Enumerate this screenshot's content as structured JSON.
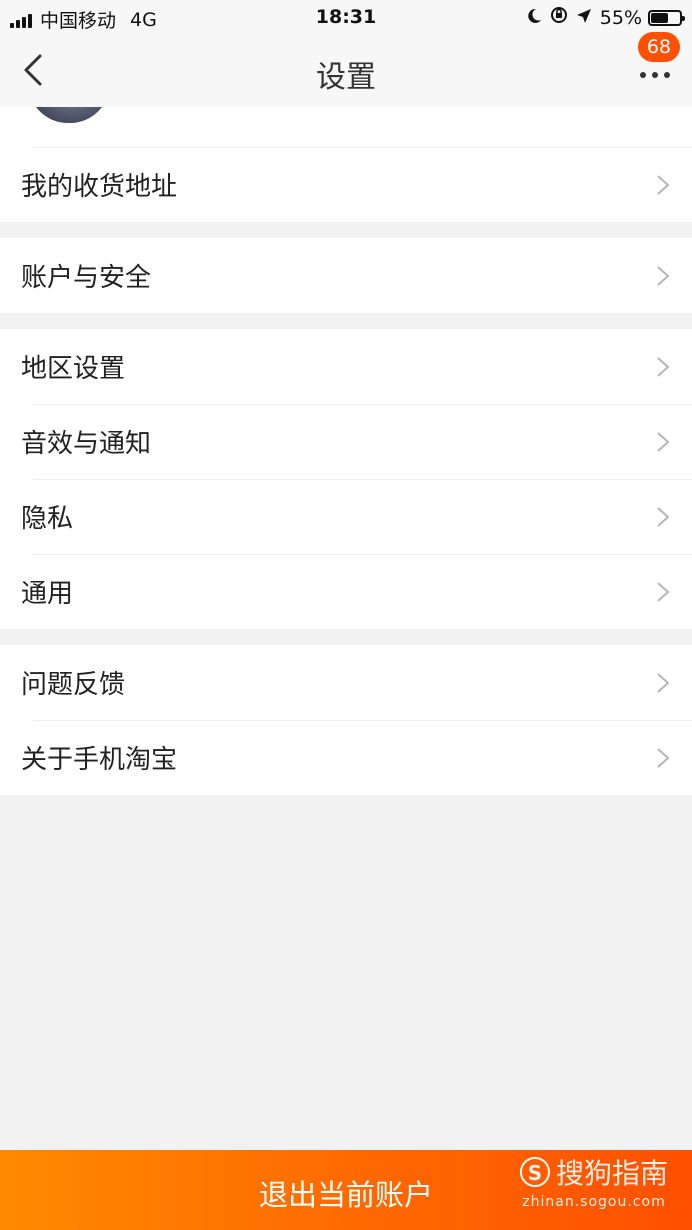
{
  "status_bar": {
    "carrier": "中国移动",
    "network": "4G",
    "time": "18:31",
    "battery": "55%",
    "battery_level": 0.55
  },
  "header": {
    "title": "设置",
    "badge_count": "68",
    "back_icon": "chevron-left-icon",
    "more_icon": "more-dots-icon"
  },
  "groups": [
    {
      "items": [
        "我的收货地址"
      ]
    },
    {
      "items": [
        "账户与安全"
      ]
    },
    {
      "items": [
        "地区设置",
        "音效与通知",
        "隐私",
        "通用"
      ]
    },
    {
      "items": [
        "问题反馈",
        "关于手机淘宝"
      ]
    }
  ],
  "logout": {
    "label": "退出当前账户"
  },
  "watermark": {
    "logo_text": "S",
    "name": "搜狗指南",
    "url": "zhinan.sogou.com"
  },
  "colors": {
    "accent": "#ff5000",
    "background": "#f2f2f2"
  }
}
